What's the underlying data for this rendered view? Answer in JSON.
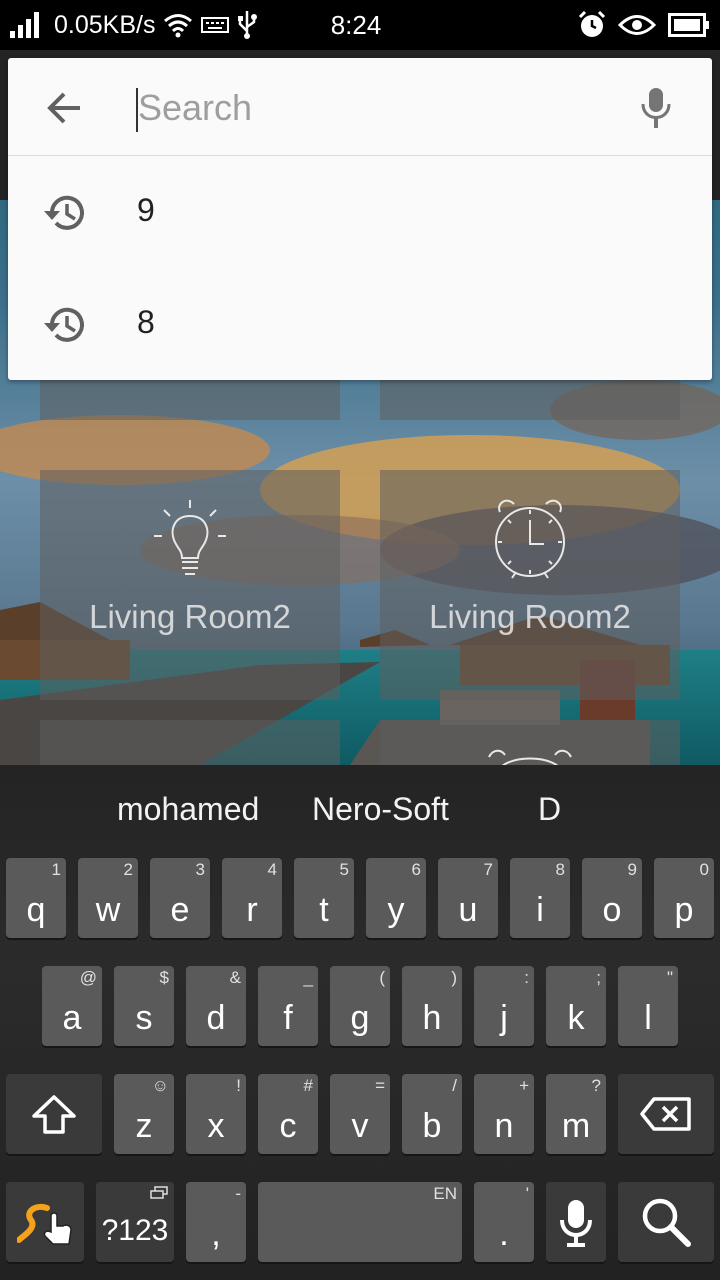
{
  "status_bar": {
    "net_speed": "0.05KB/s",
    "time": "8:24",
    "icons": [
      "signal-icon",
      "wifi-icon",
      "keyboard-icon",
      "usb-icon",
      "alarm-icon",
      "eye-icon",
      "battery-icon"
    ]
  },
  "search": {
    "placeholder": "Search",
    "value": "",
    "history": [
      {
        "label": "9"
      },
      {
        "label": "8"
      }
    ]
  },
  "tiles": [
    {
      "label": "Living Room2",
      "icon": "lightbulb-icon"
    },
    {
      "label": "Living Room2",
      "icon": "alarm-clock-icon"
    }
  ],
  "keyboard": {
    "word_suggestions": [
      "mohamed",
      "Nero-Soft",
      "D"
    ],
    "row1": [
      {
        "key": "q",
        "hint": "1"
      },
      {
        "key": "w",
        "hint": "2"
      },
      {
        "key": "e",
        "hint": "3"
      },
      {
        "key": "r",
        "hint": "4"
      },
      {
        "key": "t",
        "hint": "5"
      },
      {
        "key": "y",
        "hint": "6"
      },
      {
        "key": "u",
        "hint": "7"
      },
      {
        "key": "i",
        "hint": "8"
      },
      {
        "key": "o",
        "hint": "9"
      },
      {
        "key": "p",
        "hint": "0"
      }
    ],
    "row2": [
      {
        "key": "a",
        "hint": "@"
      },
      {
        "key": "s",
        "hint": "$"
      },
      {
        "key": "d",
        "hint": "&"
      },
      {
        "key": "f",
        "hint": "_"
      },
      {
        "key": "g",
        "hint": "("
      },
      {
        "key": "h",
        "hint": ")"
      },
      {
        "key": "j",
        "hint": ":"
      },
      {
        "key": "k",
        "hint": ";"
      },
      {
        "key": "l",
        "hint": "\""
      }
    ],
    "row3": [
      {
        "key": "z",
        "hint": "☺"
      },
      {
        "key": "x",
        "hint": "!"
      },
      {
        "key": "c",
        "hint": "#"
      },
      {
        "key": "v",
        "hint": "="
      },
      {
        "key": "b",
        "hint": "/"
      },
      {
        "key": "n",
        "hint": "+"
      },
      {
        "key": "m",
        "hint": "?"
      }
    ],
    "symbols_label": "?123",
    "comma": {
      "key": ",",
      "hint": "-"
    },
    "space_hint": "EN",
    "period": {
      "key": ".",
      "hint": "'"
    }
  }
}
